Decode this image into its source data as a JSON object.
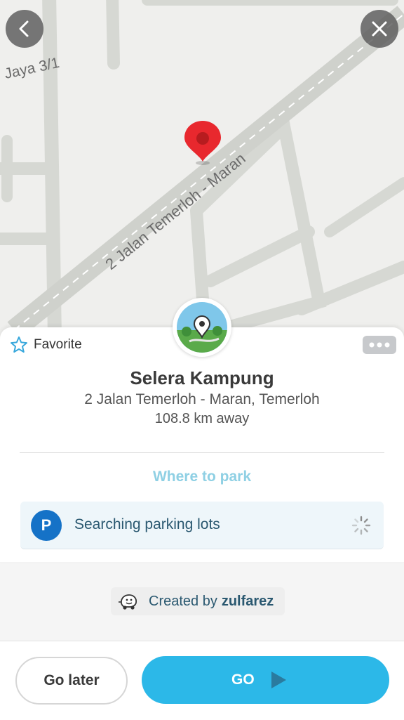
{
  "map": {
    "street_main": "2 Jalan Temerloh - Maran",
    "street_side": "Jaya 3/1"
  },
  "colors": {
    "accent": "#2cb8e8",
    "pin": "#e8282e",
    "parking": "#1572c7"
  },
  "icons": {
    "back": "chevron-left-icon",
    "close": "close-icon",
    "favorite": "star-outline-icon",
    "more": "more-dots-icon",
    "pin": "map-pin-icon",
    "parking": "parking-icon",
    "spinner": "loading-spinner-icon",
    "creator": "waze-car-icon",
    "go": "play-arrow-icon"
  },
  "card": {
    "favorite_label": "Favorite",
    "place_name": "Selera Kampung",
    "address": "2 Jalan Temerloh - Maran, Temerloh",
    "distance": "108.8 km away",
    "where_to_park": "Where to park",
    "parking_letter": "P",
    "parking_status": "Searching parking lots",
    "creator_prefix": "Created by",
    "creator_name": "zulfarez"
  },
  "actions": {
    "go_later": "Go later",
    "go": "GO"
  }
}
